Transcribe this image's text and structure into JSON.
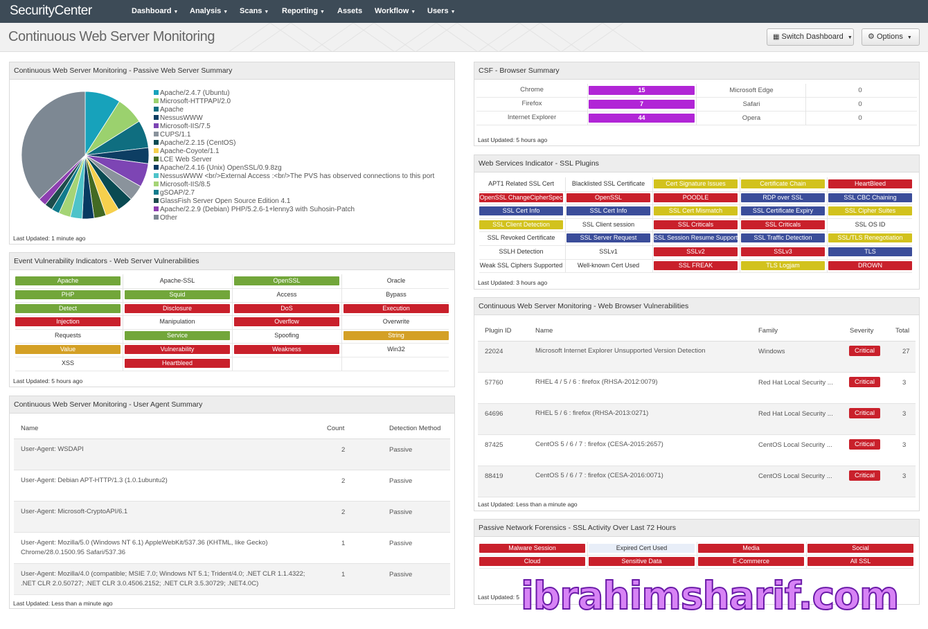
{
  "app": {
    "logo": "SecurityCenter"
  },
  "nav": [
    {
      "label": "Dashboard",
      "caret": true
    },
    {
      "label": "Analysis",
      "caret": true
    },
    {
      "label": "Scans",
      "caret": true
    },
    {
      "label": "Reporting",
      "caret": true
    },
    {
      "label": "Assets",
      "caret": false
    },
    {
      "label": "Workflow",
      "caret": true
    },
    {
      "label": "Users",
      "caret": true
    }
  ],
  "header": {
    "title": "Continuous Web Server Monitoring",
    "switch_dashboard": "Switch Dashboard",
    "options": "Options",
    "grid_icon": "grid-icon",
    "gear_icon": "gear-icon"
  },
  "passive_summary": {
    "title": "Continuous Web Server Monitoring - Passive Web Server Summary",
    "updated": "Last Updated: 1 minute ago",
    "chart_data": {
      "type": "pie",
      "legend_position": "right",
      "slices": [
        {
          "label": "Apache/2.4.7 (Ubuntu)",
          "value": 9,
          "color": "#17a2bb"
        },
        {
          "label": "Microsoft-HTTPAPI/2.0",
          "value": 7,
          "color": "#9bd16e"
        },
        {
          "label": "Apache",
          "value": 7,
          "color": "#0f6e80"
        },
        {
          "label": "NessusWWW",
          "value": 4,
          "color": "#0d3e63"
        },
        {
          "label": "Microsoft-IIS/7.5",
          "value": 6,
          "color": "#7d45b4"
        },
        {
          "label": "CUPS/1.1",
          "value": 4,
          "color": "#8a939c"
        },
        {
          "label": "Apache/2.2.15 (CentOS)",
          "value": 4,
          "color": "#0a4a52"
        },
        {
          "label": "Apache-Coyote/1.1",
          "value": 3.5,
          "color": "#f6d04d"
        },
        {
          "label": "LCE Web Server",
          "value": 3,
          "color": "#436a23"
        },
        {
          "label": "Apache/2.4.16 (Unix) OpenSSL/0.9.8zg",
          "value": 3,
          "color": "#083a61"
        },
        {
          "label": "NessusWWW <br/>External Access :<br/>The PVS has observed connections to this port",
          "value": 3,
          "color": "#4ec3c9"
        },
        {
          "label": "Microsoft-IIS/8.5",
          "value": 3,
          "color": "#a5d476"
        },
        {
          "label": "gSOAP/2.7",
          "value": 2,
          "color": "#117b8c"
        },
        {
          "label": "GlassFish Server Open Source Edition 4.1",
          "value": 2,
          "color": "#1d4c4c"
        },
        {
          "label": "Apache/2.2.9 (Debian) PHP/5.2.6-1+lenny3 with Suhosin-Patch",
          "value": 2,
          "color": "#8d3fb0"
        },
        {
          "label": "Other",
          "value": 37,
          "color": "#7d8893"
        }
      ]
    }
  },
  "event_vuln": {
    "title": "Event Vulnerability Indicators - Web Server Vulnerabilities",
    "updated": "Last Updated: 5 hours ago",
    "cells": [
      {
        "label": "Apache",
        "color": "#72a63a"
      },
      {
        "label": "Apache-SSL",
        "color": ""
      },
      {
        "label": "OpenSSL",
        "color": "#72a63a"
      },
      {
        "label": "Oracle",
        "color": ""
      },
      {
        "label": "PHP",
        "color": "#72a63a"
      },
      {
        "label": "Squid",
        "color": "#72a63a"
      },
      {
        "label": "Access",
        "color": ""
      },
      {
        "label": "Bypass",
        "color": ""
      },
      {
        "label": "Detect",
        "color": "#72a63a"
      },
      {
        "label": "Disclosure",
        "color": "#c9202b"
      },
      {
        "label": "DoS",
        "color": "#c9202b"
      },
      {
        "label": "Execution",
        "color": "#c9202b"
      },
      {
        "label": "Injection",
        "color": "#c9202b"
      },
      {
        "label": "Manipulation",
        "color": ""
      },
      {
        "label": "Overflow",
        "color": "#c9202b"
      },
      {
        "label": "Overwrite",
        "color": ""
      },
      {
        "label": "Requests",
        "color": ""
      },
      {
        "label": "Service",
        "color": "#72a63a"
      },
      {
        "label": "Spoofing",
        "color": ""
      },
      {
        "label": "String",
        "color": "#d4a025"
      },
      {
        "label": "Value",
        "color": "#d4a025"
      },
      {
        "label": "Vulnerability",
        "color": "#c9202b"
      },
      {
        "label": "Weakness",
        "color": "#c9202b"
      },
      {
        "label": "Win32",
        "color": ""
      },
      {
        "label": "XSS",
        "color": ""
      },
      {
        "label": "Heartbleed",
        "color": "#c9202b"
      }
    ]
  },
  "user_agent": {
    "title": "Continuous Web Server Monitoring - User Agent Summary",
    "updated": "Last Updated: Less than a minute ago",
    "columns": [
      "Name",
      "Count",
      "Detection Method"
    ],
    "rows": [
      {
        "name1": "User-Agent: WSDAPI",
        "name2": "",
        "count": "2",
        "method": "Passive"
      },
      {
        "name1": "User-Agent: Debian APT-HTTP/1.3 (1.0.1ubuntu2)",
        "name2": "",
        "count": "2",
        "method": "Passive"
      },
      {
        "name1": "User-Agent: Microsoft-CryptoAPI/6.1",
        "name2": "",
        "count": "2",
        "method": "Passive"
      },
      {
        "name1": "User-Agent: Mozilla/5.0 (Windows NT 6.1) AppleWebKit/537.36 (KHTML, like Gecko)",
        "name2": "Chrome/28.0.1500.95 Safari/537.36",
        "count": "1",
        "method": "Passive"
      },
      {
        "name1": "User-Agent: Mozilla/4.0 (compatible; MSIE 7.0; Windows NT 5.1; Trident/4.0; .NET CLR 1.1.4322;",
        "name2": ".NET CLR 2.0.50727; .NET CLR 3.0.4506.2152; .NET CLR 3.5.30729; .NET4.0C)",
        "count": "1",
        "method": "Passive"
      }
    ]
  },
  "browser_summary": {
    "title": "CSF - Browser Summary",
    "updated": "Last Updated: 5 hours ago",
    "bar_color": "#b125d6",
    "rows": [
      {
        "b1": "Chrome",
        "v1": "15",
        "b2": "Microsoft Edge",
        "v2": "0"
      },
      {
        "b1": "Firefox",
        "v1": "7",
        "b2": "Safari",
        "v2": "0"
      },
      {
        "b1": "Internet Explorer",
        "v1": "44",
        "b2": "Opera",
        "v2": "0"
      }
    ]
  },
  "ssl_plugins": {
    "title": "Web Services Indicator - SSL Plugins",
    "updated": "Last Updated: 3 hours ago",
    "cells": [
      {
        "label": "APT1 Related SSL Cert",
        "color": ""
      },
      {
        "label": "Blacklisted SSL Certificate",
        "color": ""
      },
      {
        "label": "Cert Signature Issues",
        "color": "#d2c21d"
      },
      {
        "label": "Certificate Chain",
        "color": "#d2c21d"
      },
      {
        "label": "HeartBleed",
        "color": "#c9202b"
      },
      {
        "label": "OpenSSL ChangeCipherSpec",
        "color": "#c9202b"
      },
      {
        "label": "OpenSSL",
        "color": "#c9202b"
      },
      {
        "label": "POODLE",
        "color": "#c9202b"
      },
      {
        "label": "RDP over SSL",
        "color": "#3b4d9a"
      },
      {
        "label": "SSL CBC Chaining",
        "color": "#3b4d9a"
      },
      {
        "label": "SSL Cert Info",
        "color": "#3b4d9a"
      },
      {
        "label": "SSL Cert Info",
        "color": "#3b4d9a"
      },
      {
        "label": "SSL Cert Mismatch",
        "color": "#d2c21d"
      },
      {
        "label": "SSL Certificate Expiry",
        "color": "#3b4d9a"
      },
      {
        "label": "SSL Cipher Suites",
        "color": "#d2c21d"
      },
      {
        "label": "SSL Client Detection",
        "color": "#d2c21d"
      },
      {
        "label": "SSL Client session",
        "color": ""
      },
      {
        "label": "SSL Criticals",
        "color": "#c9202b"
      },
      {
        "label": "SSL Criticals",
        "color": "#c9202b"
      },
      {
        "label": "SSL OS ID",
        "color": ""
      },
      {
        "label": "SSL Revoked Certificate",
        "color": ""
      },
      {
        "label": "SSL Server Request",
        "color": "#3b4d9a"
      },
      {
        "label": "SSL Session Resume Support",
        "color": "#3b4d9a"
      },
      {
        "label": "SSL Traffic Detection",
        "color": "#3b4d9a"
      },
      {
        "label": "SSL/TLS Renegotiation",
        "color": "#d2c21d"
      },
      {
        "label": "SSLH Detection",
        "color": ""
      },
      {
        "label": "SSLv1",
        "color": ""
      },
      {
        "label": "SSLv2",
        "color": "#c9202b"
      },
      {
        "label": "SSLv3",
        "color": "#c9202b"
      },
      {
        "label": "TLS",
        "color": "#3b4d9a"
      },
      {
        "label": "Weak SSL Ciphers Supported",
        "color": ""
      },
      {
        "label": "Well-known Cert Used",
        "color": ""
      },
      {
        "label": "SSL FREAK",
        "color": "#c9202b"
      },
      {
        "label": "TLS Logjam",
        "color": "#d2c21d"
      },
      {
        "label": "DROWN",
        "color": "#c9202b"
      }
    ]
  },
  "browser_vulns": {
    "title": "Continuous Web Server Monitoring - Web Browser Vulnerabilities",
    "updated": "Last Updated: Less than a minute ago",
    "columns": [
      "Plugin ID",
      "Name",
      "Family",
      "Severity",
      "Total"
    ],
    "rows": [
      {
        "id": "22024",
        "name": "Microsoft Internet Explorer Unsupported Version Detection",
        "family": "Windows",
        "severity": "Critical",
        "total": "27"
      },
      {
        "id": "57760",
        "name": "RHEL 4 / 5 / 6 : firefox (RHSA-2012:0079)",
        "family": "Red Hat Local Security ...",
        "severity": "Critical",
        "total": "3"
      },
      {
        "id": "64696",
        "name": "RHEL 5 / 6 : firefox (RHSA-2013:0271)",
        "family": "Red Hat Local Security ...",
        "severity": "Critical",
        "total": "3"
      },
      {
        "id": "87425",
        "name": "CentOS 5 / 6 / 7 : firefox (CESA-2015:2657)",
        "family": "CentOS Local Security ...",
        "severity": "Critical",
        "total": "3"
      },
      {
        "id": "88419",
        "name": "CentOS 5 / 6 / 7 : firefox (CESA-2016:0071)",
        "family": "CentOS Local Security ...",
        "severity": "Critical",
        "total": "3"
      }
    ]
  },
  "ssl_activity": {
    "title": "Passive Network Forensics - SSL Activity Over Last 72 Hours",
    "updated": "Last Updated: 5",
    "cells": [
      {
        "label": "Malware Session",
        "color": "#c9202b"
      },
      {
        "label": "Expired Cert Used",
        "color": "#e8eef8"
      },
      {
        "label": "Media",
        "color": "#c9202b"
      },
      {
        "label": "Social",
        "color": "#c9202b"
      },
      {
        "label": "Cloud",
        "color": "#c9202b"
      },
      {
        "label": "Sensitive Data",
        "color": "#c9202b"
      },
      {
        "label": "E-Commerce",
        "color": "#c9202b"
      },
      {
        "label": "All SSL",
        "color": "#c9202b"
      }
    ]
  },
  "watermark": "ibrahimsharif.com"
}
